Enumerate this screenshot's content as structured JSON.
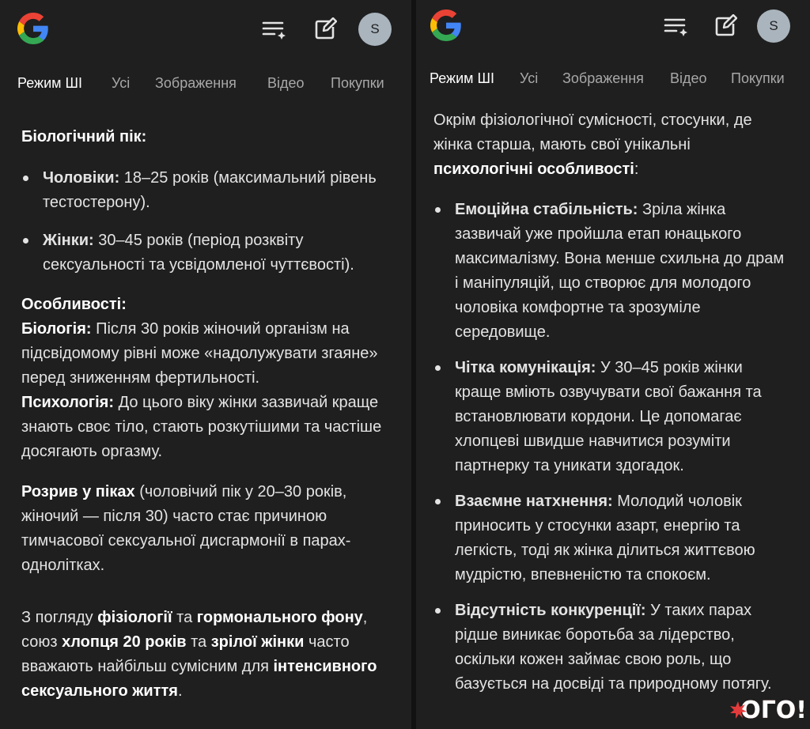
{
  "header": {
    "logo_icon": "google-g-logo",
    "menu_icon": "notes-sparkle-icon",
    "edit_icon": "edit-note-icon",
    "avatar_letter": "S"
  },
  "tabs": [
    "Режим ШІ",
    "Усі",
    "Зображення",
    "Відео",
    "Покупки"
  ],
  "left": {
    "bio_peak_heading": "Біологічний пік:",
    "bullets": [
      {
        "label": "Чоловіки:",
        "text": " 18–25 років (максимальний рівень тестостерону)."
      },
      {
        "label": "Жінки:",
        "text": " 30–45 років (період розквіту сексуальності та усвідомленої чуттєвості)."
      }
    ],
    "features_heading": "Особливості:",
    "biology_label": "Біологія:",
    "biology_text": " Після 30 років жіночий організм на підсвідомому рівні може «надолужувати згаяне» перед зниженням фертильності.",
    "psychology_label": "Психологія:",
    "psychology_text": " До цього віку жінки зазвичай краще знають своє тіло, стають розкутішими та частіше досягають оргазму.",
    "gap_label": "Розрив у піках",
    "gap_text": " (чоловічий пік у 20–30 років, жіночий — після 30) часто стає причиною тимчасової сексуальної дисгармонії в парах-однолітках.",
    "concl_1": "З погляду ",
    "concl_b1": "фізіології",
    "concl_2": " та ",
    "concl_b2": "гормонального фону",
    "concl_3": ", союз ",
    "concl_b3": "хлопця 20 років",
    "concl_4": " та ",
    "concl_b4": "зрілої жінки",
    "concl_5": " часто вважають найбільш сумісним для ",
    "concl_b5": "інтенсивного сексуального життя",
    "concl_6": "."
  },
  "right": {
    "intro_text": "Окрім фізіологічної сумісності, стосунки, де жінка старша, мають свої унікальні ",
    "intro_bold": "психологічні особливості",
    "intro_end": ":",
    "bullets": [
      {
        "label": "Емоційна стабільність:",
        "text": " Зріла жінка зазвичай уже пройшла етап юнацького максималізму. Вона менше схильна до драм і маніпуляцій, що створює для молодого чоловіка комфортне та зрозуміле середовище."
      },
      {
        "label": "Чітка комунікація:",
        "text": " У 30–45 років жінки краще вміють озвучувати свої бажання та встановлювати кордони. Це допомагає хлопцеві швидше навчитися розуміти партнерку та уникати здогадок."
      },
      {
        "label": "Взаємне натхнення:",
        "text": " Молодий чоловік приносить у стосунки азарт, енергію та легкість, тоді як жінка ділиться життєвою мудрістю, впевненістю та спокоєм."
      },
      {
        "label": "Відсутність конкуренції:",
        "text": " У таких парах рідше виникає боротьба за лідерство, оскільки кожен займає свою роль, що базується на досвіді та природному потягу."
      }
    ]
  },
  "watermark": "ОГО!"
}
